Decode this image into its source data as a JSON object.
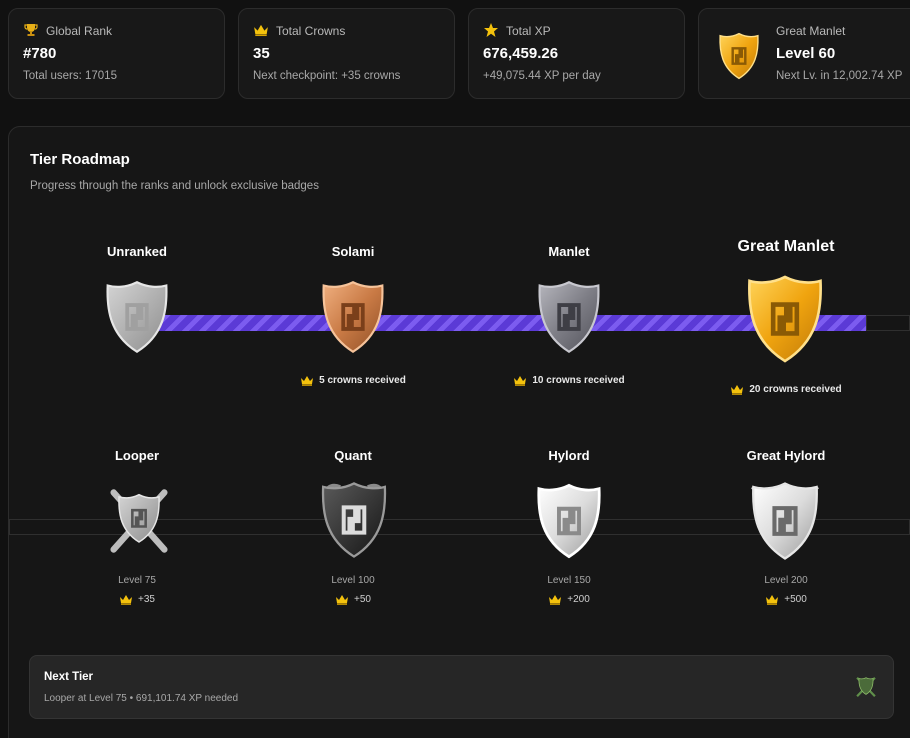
{
  "stats": {
    "rank": {
      "label": "Global Rank",
      "value": "#780",
      "sub": "Total users: 17015",
      "icon": "trophy-icon"
    },
    "crowns": {
      "label": "Total Crowns",
      "value": "35",
      "sub": "Next checkpoint: +35 crowns",
      "icon": "crown-icon"
    },
    "xp": {
      "label": "Total XP",
      "value": "676,459.26",
      "sub": "+49,075.44 XP per day",
      "icon": "star-icon"
    },
    "level": {
      "label": "Great Manlet",
      "value": "Level 60",
      "sub": "Next Lv. in 12,002.74 XP",
      "icon": "gold-shield-badge-icon"
    }
  },
  "roadmap": {
    "title": "Tier Roadmap",
    "subtitle": "Progress through the ranks and unlock exclusive badges",
    "row1": [
      {
        "name": "Unranked",
        "note": "",
        "badge": "silver"
      },
      {
        "name": "Solami",
        "note": "5 crowns received",
        "badge": "bronze"
      },
      {
        "name": "Manlet",
        "note": "10 crowns received",
        "badge": "steel"
      },
      {
        "name": "Great Manlet",
        "note": "20 crowns received",
        "badge": "gold"
      }
    ],
    "row2": [
      {
        "name": "Looper",
        "level": "Level 75",
        "bonus": "+35",
        "badge": "crossed-silver"
      },
      {
        "name": "Quant",
        "level": "Level 100",
        "bonus": "+50",
        "badge": "dark"
      },
      {
        "name": "Hylord",
        "level": "Level 150",
        "bonus": "+200",
        "badge": "shining-silver"
      },
      {
        "name": "Great Hylord",
        "level": "Level 200",
        "bonus": "+500",
        "badge": "winged-silver"
      }
    ]
  },
  "next_tier": {
    "title": "Next Tier",
    "detail": "Looper at Level 75 • 691,101.74 XP needed",
    "icon": "shield-emblem-icon"
  },
  "colors": {
    "background": "#111111",
    "card": "#181818",
    "progress": "#6a48e4",
    "gold": "#f0a40f",
    "bronze": "#c97a45"
  }
}
